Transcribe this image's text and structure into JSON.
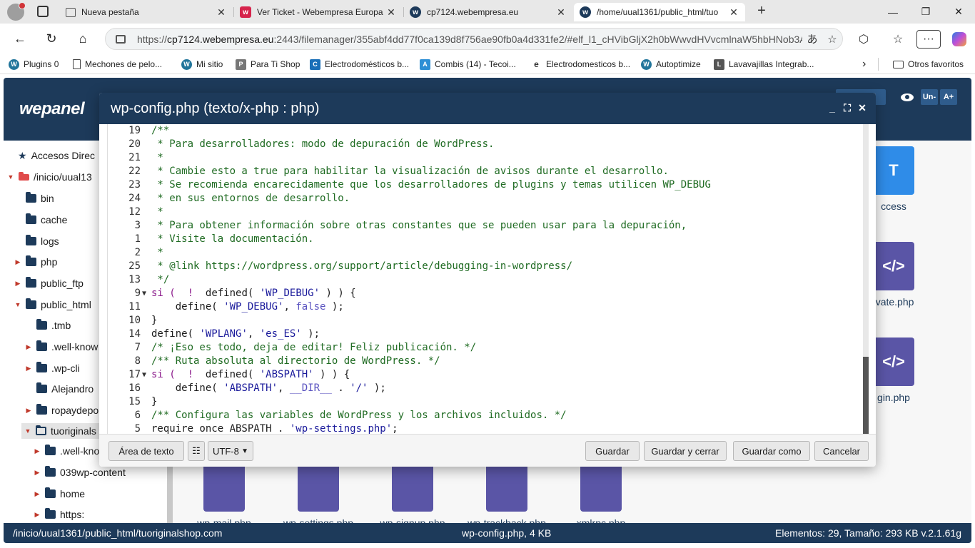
{
  "browser": {
    "tabs": [
      {
        "title": "Nueva pestaña",
        "favicon": "new-tab-icon",
        "active": false
      },
      {
        "title": "Ver Ticket - Webempresa Europa",
        "favicon": "webempresa-icon",
        "active": false
      },
      {
        "title": "cp7124.webempresa.eu",
        "favicon": "wepanel-icon",
        "active": false
      },
      {
        "title": "/home/uual1361/public_html/tuo",
        "favicon": "wepanel-icon",
        "active": true
      }
    ],
    "url_prefix": "https://",
    "url_host": "cp7124.webempresa.eu",
    "url_rest": ":2443/filemanager/355abf4dd77f0ca139d8f756ae90fb0a4d331fe2/#elf_l1_cHVibGljX2h0bWwvdHVvcmlnaW5hbHNob3AuY29tL3dwLWNvbmZpZy5waHA",
    "bookmarks": [
      {
        "label": "Plugins 0",
        "icon": "wordpress-icon"
      },
      {
        "label": "Mechones de pelo...",
        "icon": "document-icon"
      },
      {
        "label": "Mi sitio",
        "icon": "wordpress-icon"
      },
      {
        "label": "Para Ti Shop",
        "icon": "parrot-icon"
      },
      {
        "label": "Electrodomésticos b...",
        "icon": "bookmark-site-icon"
      },
      {
        "label": "Combis (14) - Tecoi...",
        "icon": "bookmark-site-icon"
      },
      {
        "label": "Electrodomesticos b...",
        "icon": "bookmark-site-icon"
      },
      {
        "label": "Autoptimize",
        "icon": "wordpress-icon"
      },
      {
        "label": "Lavavajillas Integrab...",
        "icon": "bookmark-site-icon"
      }
    ],
    "other_bookmarks": "Otros favoritos"
  },
  "app": {
    "logo": "wepanel",
    "header_buttons": [
      "Un-",
      "A+"
    ]
  },
  "sidebar": {
    "items": [
      {
        "label": "Accesos Direc",
        "icon": "star-icon"
      },
      {
        "label": "/inicio/uual13",
        "icon": "drive-icon",
        "expanded": true
      },
      {
        "label": "bin"
      },
      {
        "label": "cache"
      },
      {
        "label": "logs"
      },
      {
        "label": "php",
        "collapsed": true
      },
      {
        "label": "public_ftp",
        "collapsed": true
      },
      {
        "label": "public_html",
        "expanded": true
      },
      {
        "label": ".tmb"
      },
      {
        "label": ".well-know",
        "collapsed": true
      },
      {
        "label": ".wp-cli",
        "collapsed": true
      },
      {
        "label": "Alejandro"
      },
      {
        "label": "ropaydepo",
        "collapsed": true
      },
      {
        "label": "tuoriginals",
        "expanded": true,
        "selected": true
      },
      {
        "label": ".well-kno",
        "collapsed": true
      },
      {
        "label": "039wp-content",
        "collapsed": true
      },
      {
        "label": "home",
        "collapsed": true
      },
      {
        "label": "https:",
        "collapsed": true
      }
    ]
  },
  "files": {
    "partial_right": [
      {
        "label": "ccess"
      },
      {
        "label": "ivate.php"
      },
      {
        "label": "gin.php"
      }
    ],
    "bottom_row": [
      "wp-mail.php",
      "wp-settings.php",
      "wp-signup.php",
      "wp-trackback.php",
      "xmlrpc.php"
    ]
  },
  "status": {
    "path": "/inicio/uual1361/public_html/tuoriginalshop.com",
    "file": "wp-config.php, 4 KB",
    "summary": "Elementos: 29, Tamaño: 293 KB v.2.1.61g"
  },
  "dialog": {
    "title": "wp-config.php (texto/x-php : php)",
    "code_lines": [
      {
        "n": "19",
        "code": "/**"
      },
      {
        "n": "20",
        "code": " * Para desarrolladores: modo de depuración de WordPress."
      },
      {
        "n": "21",
        "code": " *"
      },
      {
        "n": "22",
        "code": " * Cambie esto a true para habilitar la visualización de avisos durante el desarrollo."
      },
      {
        "n": "23",
        "code": " * Se recomienda encarecidamente que los desarrolladores de plugins y temas utilicen WP_DEBUG"
      },
      {
        "n": "24",
        "code": " * en sus entornos de desarrollo."
      },
      {
        "n": "12",
        "code": " *"
      },
      {
        "n": "3",
        "code": " * Para obtener información sobre otras constantes que se pueden usar para la depuración,"
      },
      {
        "n": "1",
        "code": " * Visite la documentación."
      },
      {
        "n": "2",
        "code": " *"
      },
      {
        "n": "25",
        "code": " * @link https://wordpress.org/support/article/debugging-in-wordpress/"
      },
      {
        "n": "13",
        "code": " */"
      },
      {
        "n": "9",
        "code": "si (  !  defined( 'WP_DEBUG' ) ) {",
        "fold": true
      },
      {
        "n": "11",
        "code": "    define( 'WP_DEBUG', false );"
      },
      {
        "n": "10",
        "code": "}"
      },
      {
        "n": "14",
        "code": "define( 'WPLANG', 'es_ES' );"
      },
      {
        "n": "7",
        "code": "/* ¡Eso es todo, deja de editar! Feliz publicación. */"
      },
      {
        "n": "8",
        "code": "/** Ruta absoluta al directorio de WordPress. */"
      },
      {
        "n": "17",
        "code": "si (  !  defined( 'ABSPATH' ) ) {",
        "fold": true
      },
      {
        "n": "16",
        "code": "    define( 'ABSPATH', __DIR__ . '/' );"
      },
      {
        "n": "15",
        "code": "}"
      },
      {
        "n": "6",
        "code": "/** Configura las variables de WordPress y los archivos incluidos. */"
      },
      {
        "n": "5",
        "code": "require_once ABSPATH . 'wp-settings.php';"
      }
    ],
    "footer": {
      "text_area_btn": "Área de texto",
      "encoding": "UTF-8",
      "save": "Guardar",
      "save_close": "Guardar y cerrar",
      "save_as": "Guardar como",
      "cancel": "Cancelar"
    }
  }
}
